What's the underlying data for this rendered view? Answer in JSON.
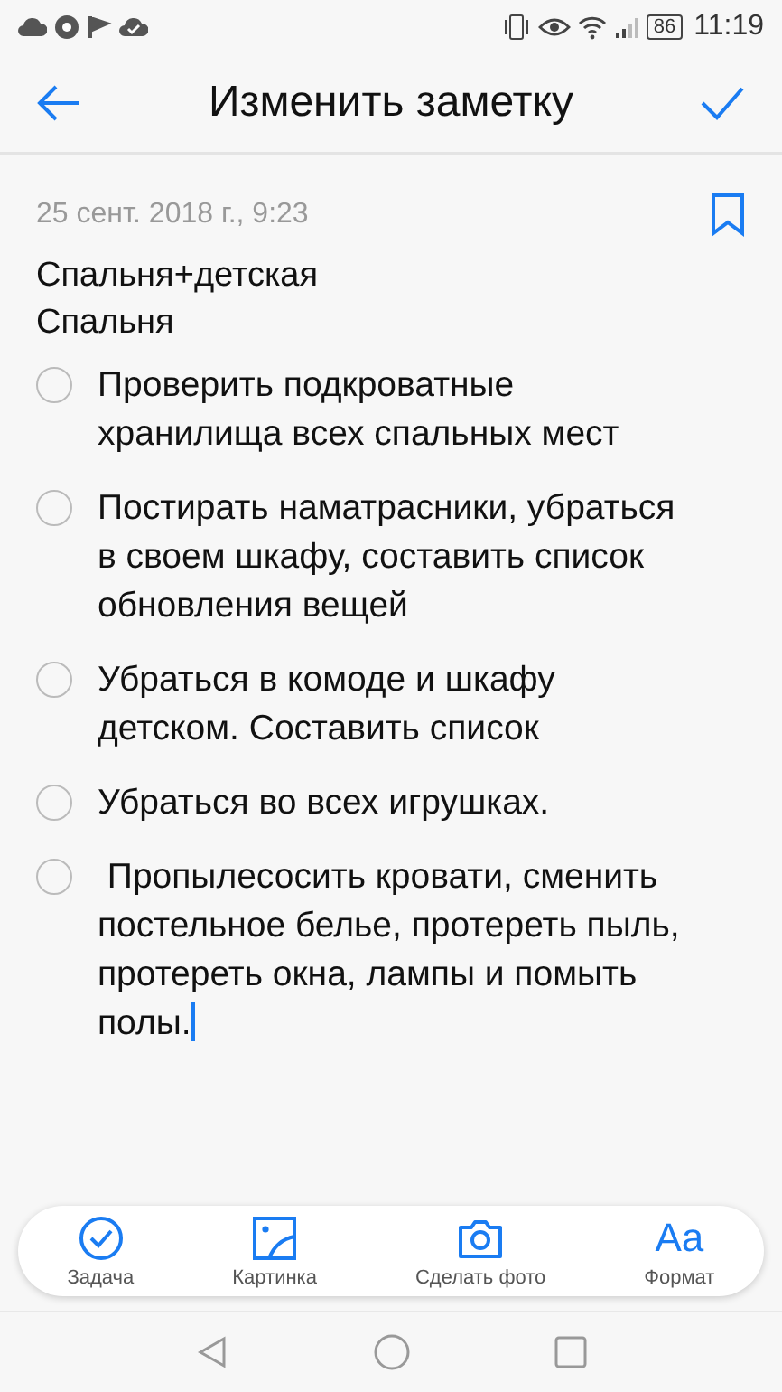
{
  "status_bar": {
    "battery": "86",
    "time": "11:19"
  },
  "header": {
    "title": "Изменить заметку"
  },
  "note": {
    "date": "25 сент. 2018 г., 9:23",
    "bookmarked": false,
    "lines": [
      "Спальня+детская",
      "Спальня"
    ],
    "tasks": [
      {
        "text": "Проверить подкроватные хранилища всех спальных мест",
        "checked": false
      },
      {
        "text": "Постирать наматрасники, убраться в своем шкафу, составить список обновления вещей",
        "checked": false
      },
      {
        "text": "Убраться в комоде и шкафу детском. Составить список",
        "checked": false
      },
      {
        "text": "Убраться во всех игрушках.",
        "checked": false
      },
      {
        "text": " Пропылесосить кровати, сменить постельное белье, протереть пыль, протереть окна, лампы и помыть полы.",
        "checked": false,
        "cursor": true
      }
    ]
  },
  "toolbar": [
    {
      "kind": "task",
      "label": "Задача"
    },
    {
      "kind": "image",
      "label": "Картинка"
    },
    {
      "kind": "camera",
      "label": "Сделать фото"
    },
    {
      "kind": "format",
      "label": "Формат",
      "glyph": "Aa"
    }
  ]
}
